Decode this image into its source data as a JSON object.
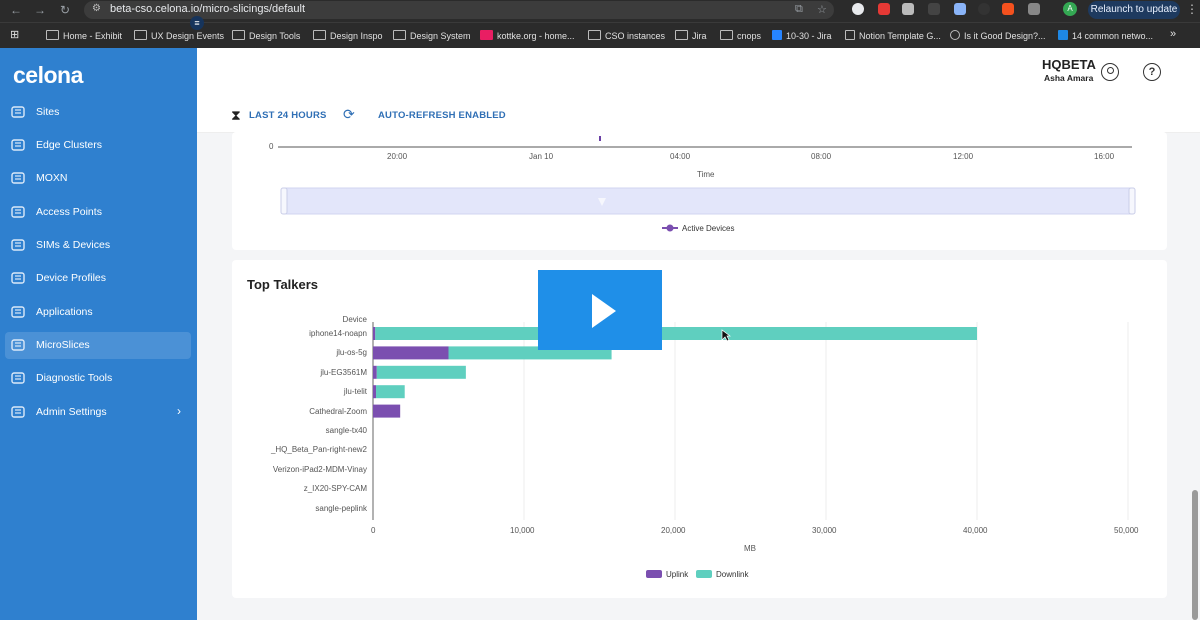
{
  "browser": {
    "url": "beta-cso.celona.io/micro-slicings/default",
    "relaunch_label": "Relaunch to update",
    "profile_initial": "A",
    "bookmarks": [
      "Home - Exhibit",
      "UX Design Events",
      "Design Tools",
      "Design Inspo",
      "Design System",
      "kottke.org - home...",
      "CSO instances",
      "Jira",
      "cnops",
      "10-30 - Jira",
      "Notion Template G...",
      "Is it Good Design?...",
      "14 common netwo..."
    ]
  },
  "app": {
    "logo": "celona",
    "org": "HQBETA",
    "user": "Asha Amara",
    "nav": [
      {
        "label": "Sites",
        "icon": "sites-icon"
      },
      {
        "label": "Edge Clusters",
        "icon": "edge-clusters-icon"
      },
      {
        "label": "MOXN",
        "icon": "moxn-icon"
      },
      {
        "label": "Access Points",
        "icon": "access-points-icon"
      },
      {
        "label": "SIMs & Devices",
        "icon": "sims-devices-icon"
      },
      {
        "label": "Device Profiles",
        "icon": "device-profiles-icon"
      },
      {
        "label": "Applications",
        "icon": "applications-icon"
      },
      {
        "label": "MicroSlices",
        "icon": "microslices-icon",
        "active": true
      },
      {
        "label": "Diagnostic Tools",
        "icon": "diagnostic-tools-icon"
      },
      {
        "label": "Admin Settings",
        "icon": "admin-settings-icon"
      }
    ],
    "filters": {
      "time_range": "LAST 24 HOURS",
      "refresh": "AUTO-REFRESH ENABLED"
    }
  },
  "active_devices_chart": {
    "y_tick": "0",
    "x_ticks": [
      "20:00",
      "Jan 10",
      "04:00",
      "08:00",
      "12:00",
      "16:00"
    ],
    "xlabel": "Time",
    "legend": "Active Devices"
  },
  "chart_data": {
    "type": "bar",
    "orientation": "horizontal",
    "stacked": true,
    "title": "Top Talkers",
    "ylabel": "Device",
    "xlabel": "MB",
    "xlim": [
      0,
      50000
    ],
    "x_ticks": [
      "0",
      "10,000",
      "20,000",
      "30,000",
      "40,000",
      "50,000"
    ],
    "categories": [
      "iphone14-noapn",
      "jlu-os-5g",
      "jlu-EG3561M",
      "jlu-telit",
      "Cathedral-Zoom",
      "sangle-tx40",
      "_HQ_Beta_Pan-right-new2",
      "Verizon-iPad2-MDM-Vinay",
      "z_IX20-SPY-CAM",
      "sangle-peplink"
    ],
    "series": [
      {
        "name": "Uplink",
        "color": "#7b4fb0",
        "values": [
          150,
          5000,
          250,
          200,
          1800,
          0,
          0,
          0,
          0,
          0
        ]
      },
      {
        "name": "Downlink",
        "color": "#5fcfbf",
        "values": [
          39850,
          10800,
          5900,
          1900,
          0,
          0,
          0,
          0,
          0,
          0
        ]
      }
    ],
    "legend_position": "bottom",
    "grid": true
  }
}
